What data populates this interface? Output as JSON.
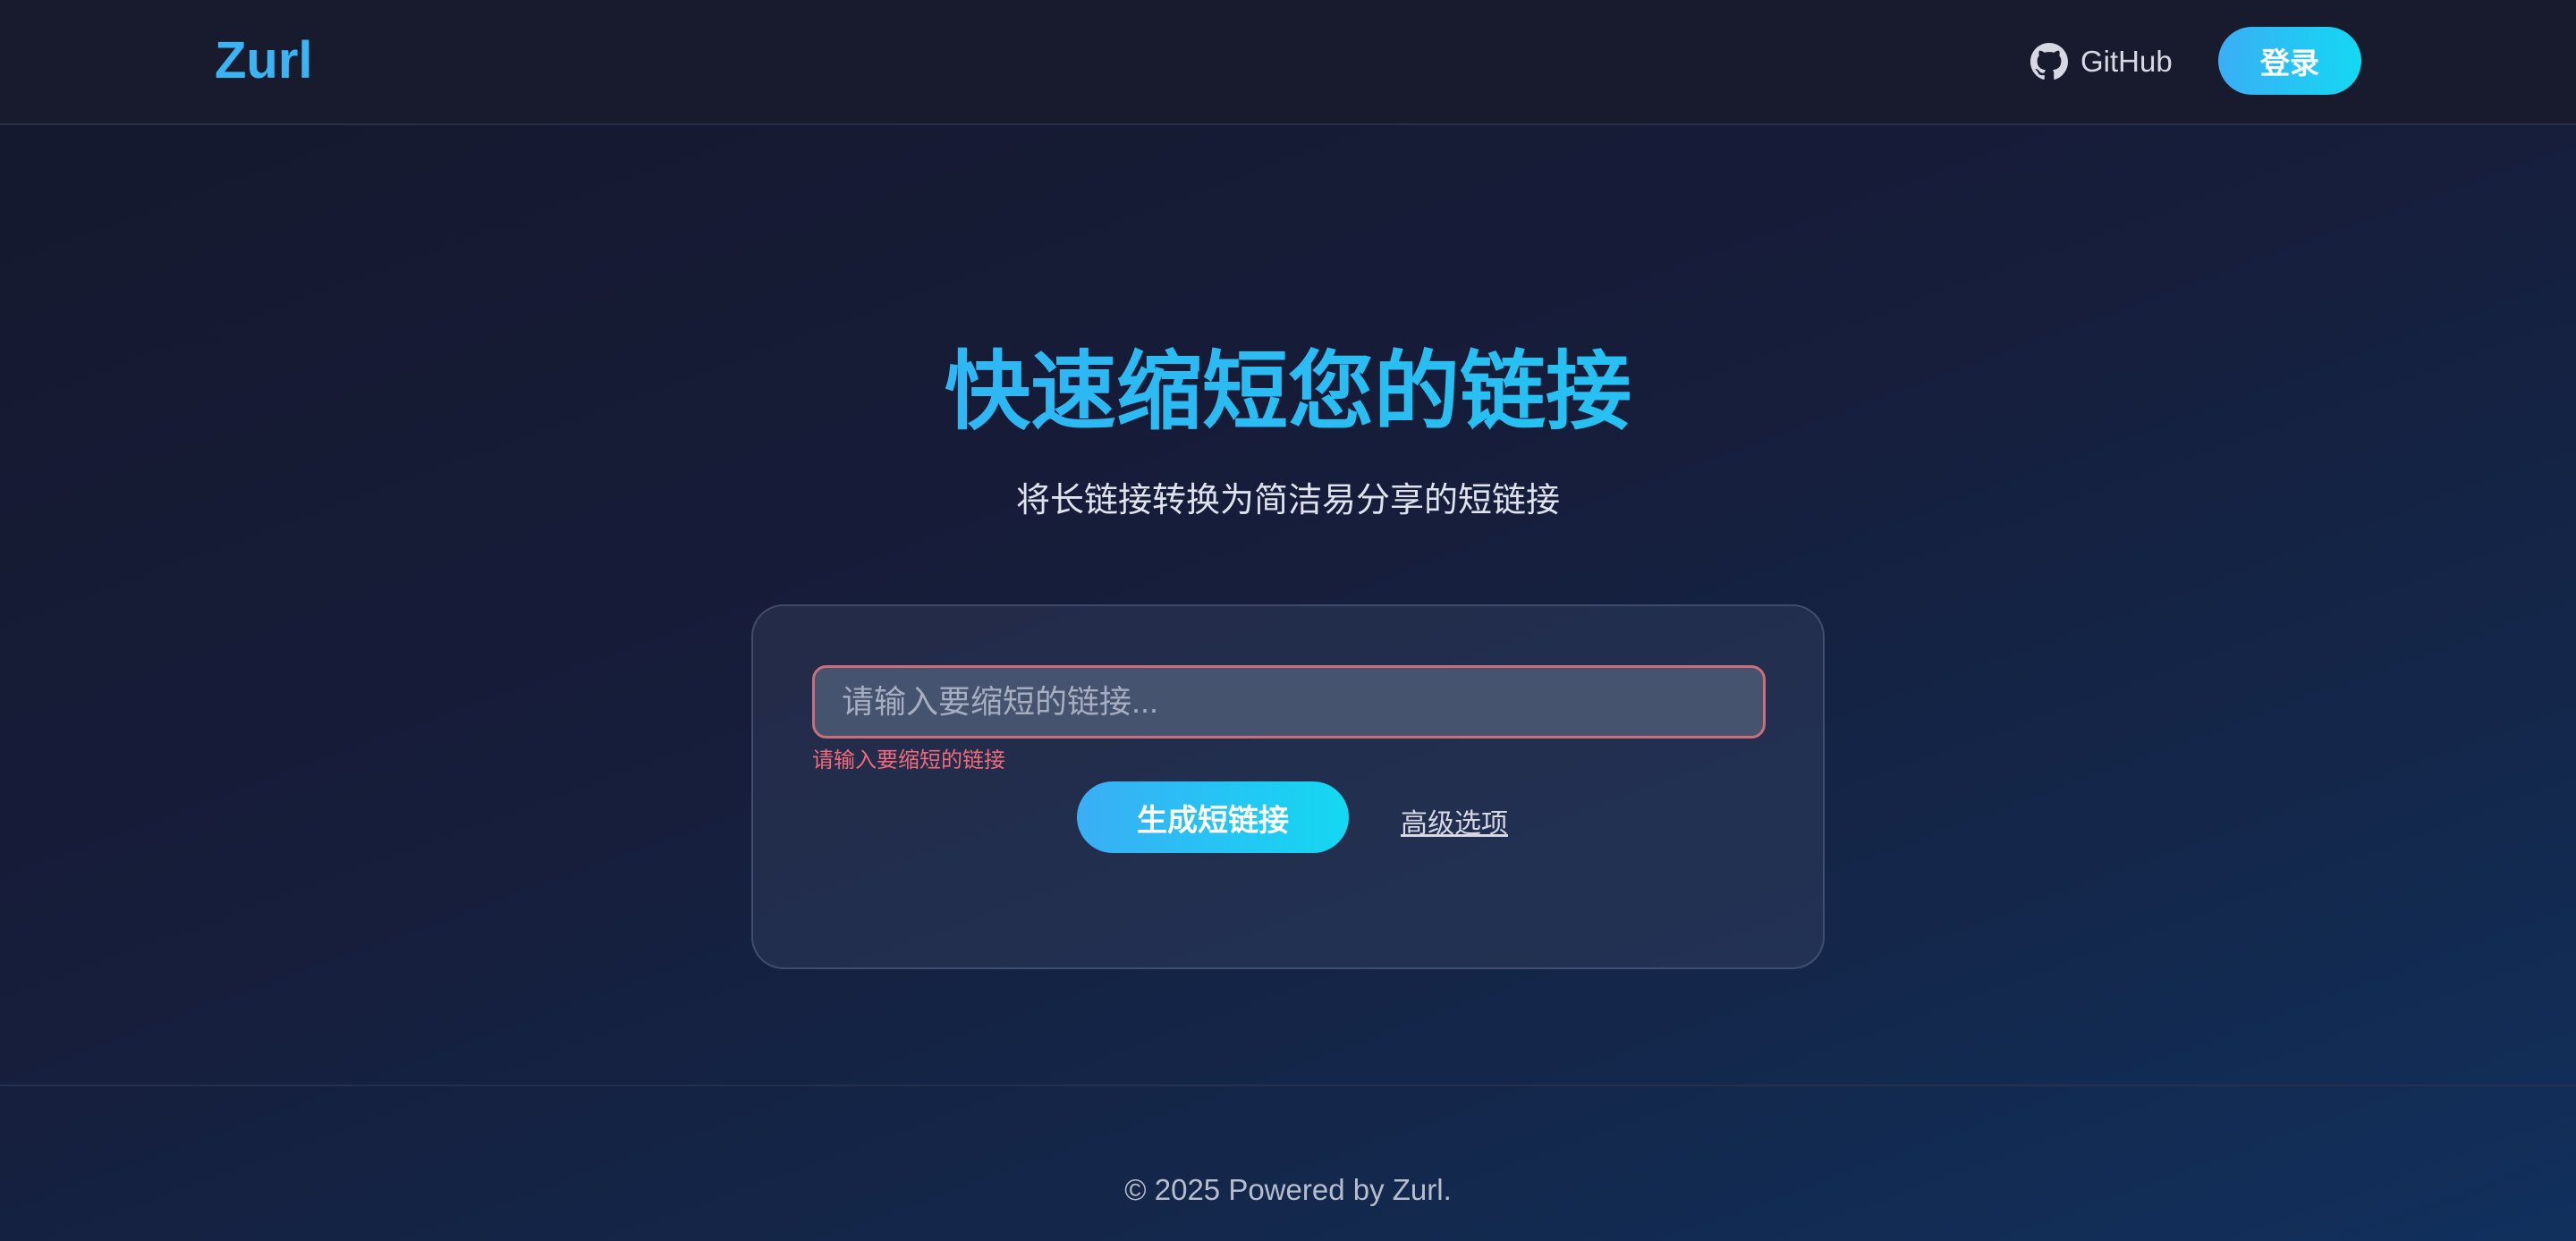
{
  "header": {
    "logo": "Zurl",
    "github_label": "GitHub",
    "login_label": "登录"
  },
  "hero": {
    "title": "快速缩短您的链接",
    "subtitle": "将长链接转换为简洁易分享的短链接"
  },
  "form": {
    "url_placeholder": "请输入要缩短的链接...",
    "url_value": "",
    "error": "请输入要缩短的链接",
    "generate_label": "生成短链接",
    "advanced_label": "高级选项"
  },
  "footer": {
    "text": "© 2025 Powered by Zurl."
  },
  "icons": {
    "github": "github-icon"
  },
  "colors": {
    "accent": "#3ab4f2",
    "accent_end": "#14d8f2",
    "error": "#f06a7a",
    "header_bg": "#181a2e"
  }
}
